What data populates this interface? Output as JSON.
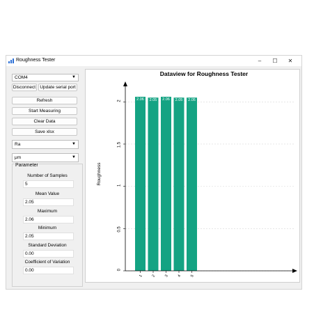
{
  "window": {
    "title": "Roughness Tester",
    "minimize": "–",
    "maximize": "☐",
    "close": "✕"
  },
  "controls": {
    "port": "COM4",
    "disconnect": "Disconnect",
    "update_port": "Update serial port",
    "refresh": "Refresh",
    "start": "Start Measuring",
    "clear": "Clear Data",
    "save": "Save xlsx",
    "parameter_select": "Ra",
    "unit_select": "μm"
  },
  "parameter": {
    "title": "Parameter",
    "fields": [
      {
        "label": "Number of Samples",
        "value": "5"
      },
      {
        "label": "Mean Value",
        "value": "2.05"
      },
      {
        "label": "Maximum",
        "value": "2.06"
      },
      {
        "label": "Minimum",
        "value": "2.05"
      },
      {
        "label": "Standard Deviation",
        "value": "0.00"
      },
      {
        "label": "Coefficient of Variation",
        "value": "0.00"
      }
    ]
  },
  "colors": {
    "bar": "#14a383",
    "accent": "#1e6fd9"
  },
  "chart_data": {
    "type": "bar",
    "title": "Dataview for Roughness Tester",
    "ylabel": "Roughness",
    "categories": [
      "1",
      "2",
      "3",
      "4",
      "5"
    ],
    "values": [
      2.06,
      2.05,
      2.06,
      2.05,
      2.05
    ],
    "data_labels": [
      "2.06",
      "2.05",
      "2.06",
      "2.05",
      "2.05"
    ],
    "ylim": [
      0,
      2.2
    ],
    "ytick_values": [
      0,
      0.5,
      1.0,
      1.5,
      2.0
    ],
    "ytick_labels": [
      "0",
      "0.5",
      "1",
      "1.5",
      "2"
    ],
    "grid": true
  }
}
